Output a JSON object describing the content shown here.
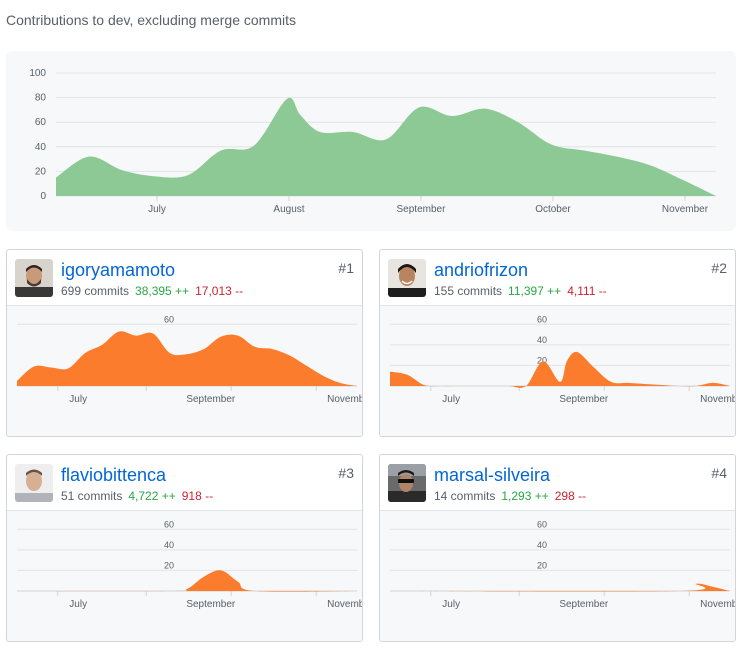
{
  "heading": "Contributions to dev, excluding merge commits",
  "colors": {
    "overview_area": "#8cc995",
    "contributor_area": "#fb7c2c",
    "link": "#0366d6",
    "additions": "#28a745",
    "deletions": "#cb2431"
  },
  "chart_data": [
    {
      "type": "area",
      "title": "",
      "ylim": [
        0,
        100
      ],
      "y_ticks": [
        "0",
        "20",
        "40",
        "60",
        "80",
        "100"
      ],
      "x_ticks": [
        "July",
        "August",
        "September",
        "October",
        "November"
      ],
      "x_tick_positions": [
        0.153,
        0.353,
        0.553,
        0.753,
        0.953
      ],
      "series": [
        {
          "x": [
            0,
            0.05,
            0.1,
            0.15,
            0.2,
            0.25,
            0.3,
            0.35,
            0.37,
            0.4,
            0.45,
            0.5,
            0.55,
            0.6,
            0.65,
            0.7,
            0.75,
            0.8,
            0.85,
            0.9,
            0.95,
            1
          ],
          "values": [
            15,
            32,
            21,
            16,
            17,
            37,
            41,
            79,
            66,
            52,
            52,
            46,
            72,
            65,
            71,
            60,
            42,
            37,
            32,
            25,
            13,
            0
          ]
        }
      ]
    },
    {
      "type": "area",
      "ylim": [
        0,
        70
      ],
      "y_ticks": [
        "60"
      ],
      "x_ticks": [
        "July",
        "September",
        "November"
      ],
      "series": [
        {
          "x": [
            0,
            0.05,
            0.1,
            0.15,
            0.2,
            0.25,
            0.3,
            0.35,
            0.4,
            0.45,
            0.5,
            0.55,
            0.6,
            0.65,
            0.7,
            0.75,
            0.8,
            0.85,
            0.9,
            0.95,
            1
          ],
          "values": [
            5,
            19,
            18,
            17,
            32,
            40,
            53,
            49,
            51,
            32,
            31,
            36,
            48,
            49,
            38,
            36,
            30,
            20,
            10,
            3,
            0
          ]
        }
      ]
    },
    {
      "type": "area",
      "ylim": [
        0,
        70
      ],
      "y_ticks": [
        "60",
        "40",
        "20"
      ],
      "x_ticks": [
        "July",
        "September",
        "November"
      ],
      "series": [
        {
          "x": [
            0,
            0.05,
            0.1,
            0.15,
            0.2,
            0.25,
            0.3,
            0.35,
            0.4,
            0.45,
            0.5,
            0.52,
            0.55,
            0.6,
            0.65,
            0.7,
            0.75,
            0.8,
            0.85,
            0.9,
            0.95,
            1
          ],
          "values": [
            14,
            11,
            1,
            0,
            0,
            0,
            0,
            0,
            0,
            24,
            4,
            24,
            33,
            18,
            4,
            3,
            2,
            1,
            0,
            0,
            3,
            0
          ]
        }
      ]
    },
    {
      "type": "area",
      "ylim": [
        0,
        70
      ],
      "y_ticks": [
        "60",
        "40",
        "20"
      ],
      "x_ticks": [
        "July",
        "September",
        "November"
      ],
      "series": [
        {
          "x": [
            0,
            0.45,
            0.5,
            0.55,
            0.6,
            0.65,
            0.7,
            1
          ],
          "values": [
            0,
            0,
            2,
            14,
            20,
            9,
            0,
            0
          ]
        }
      ]
    },
    {
      "type": "area",
      "ylim": [
        0,
        70
      ],
      "y_ticks": [
        "60",
        "40",
        "20"
      ],
      "x_ticks": [
        "July",
        "September",
        "November"
      ],
      "series": [
        {
          "x": [
            0,
            0.85,
            0.9,
            0.95,
            1
          ],
          "values": [
            0,
            0,
            7,
            4,
            0
          ]
        }
      ]
    }
  ],
  "contributors": [
    {
      "login": "igoryamamoto",
      "commits": "699 commits",
      "additions": "38,395 ++",
      "deletions": "17,013 --",
      "rank": "#1",
      "avatar": "avatar-igoryamamoto"
    },
    {
      "login": "andriofrizon",
      "commits": "155 commits",
      "additions": "11,397 ++",
      "deletions": "4,111 --",
      "rank": "#2",
      "avatar": "avatar-andriofrizon"
    },
    {
      "login": "flaviobittenca",
      "commits": "51 commits",
      "additions": "4,722 ++",
      "deletions": "918 --",
      "rank": "#3",
      "avatar": "avatar-flaviobittenca"
    },
    {
      "login": "marsal-silveira",
      "commits": "14 commits",
      "additions": "1,293 ++",
      "deletions": "298 --",
      "rank": "#4",
      "avatar": "avatar-marsal-silveira"
    }
  ]
}
